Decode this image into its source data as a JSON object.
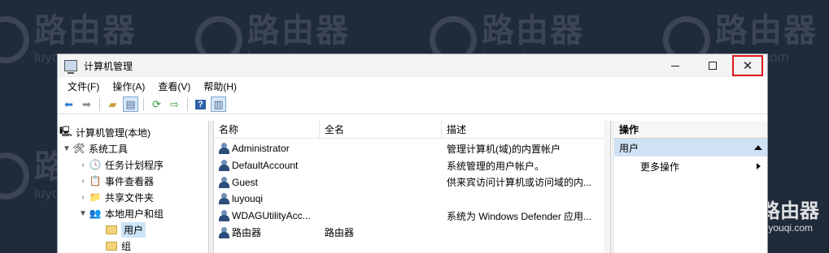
{
  "watermark": {
    "cn": "路由器",
    "en": "luyouqi.com"
  },
  "window": {
    "title": "计算机管理"
  },
  "menubar": [
    "文件(F)",
    "操作(A)",
    "查看(V)",
    "帮助(H)"
  ],
  "tree": {
    "root": "计算机管理(本地)",
    "system_tools": "系统工具",
    "task_scheduler": "任务计划程序",
    "event_viewer": "事件查看器",
    "shared_folders": "共享文件夹",
    "local_users_groups": "本地用户和组",
    "users": "用户",
    "groups": "组"
  },
  "list": {
    "headers": {
      "name": "名称",
      "fullname": "全名",
      "description": "描述"
    },
    "rows": [
      {
        "name": "Administrator",
        "fullname": "",
        "description": "管理计算机(域)的内置帐户"
      },
      {
        "name": "DefaultAccount",
        "fullname": "",
        "description": "系统管理的用户帐户。"
      },
      {
        "name": "Guest",
        "fullname": "",
        "description": "供来宾访问计算机或访问域的内..."
      },
      {
        "name": "luyouqi",
        "fullname": "",
        "description": ""
      },
      {
        "name": "WDAGUtilityAcc...",
        "fullname": "",
        "description": "系统为 Windows Defender 应用..."
      },
      {
        "name": "路由器",
        "fullname": "路由器",
        "description": ""
      }
    ]
  },
  "actions": {
    "header": "操作",
    "section": "用户",
    "more": "更多操作"
  }
}
